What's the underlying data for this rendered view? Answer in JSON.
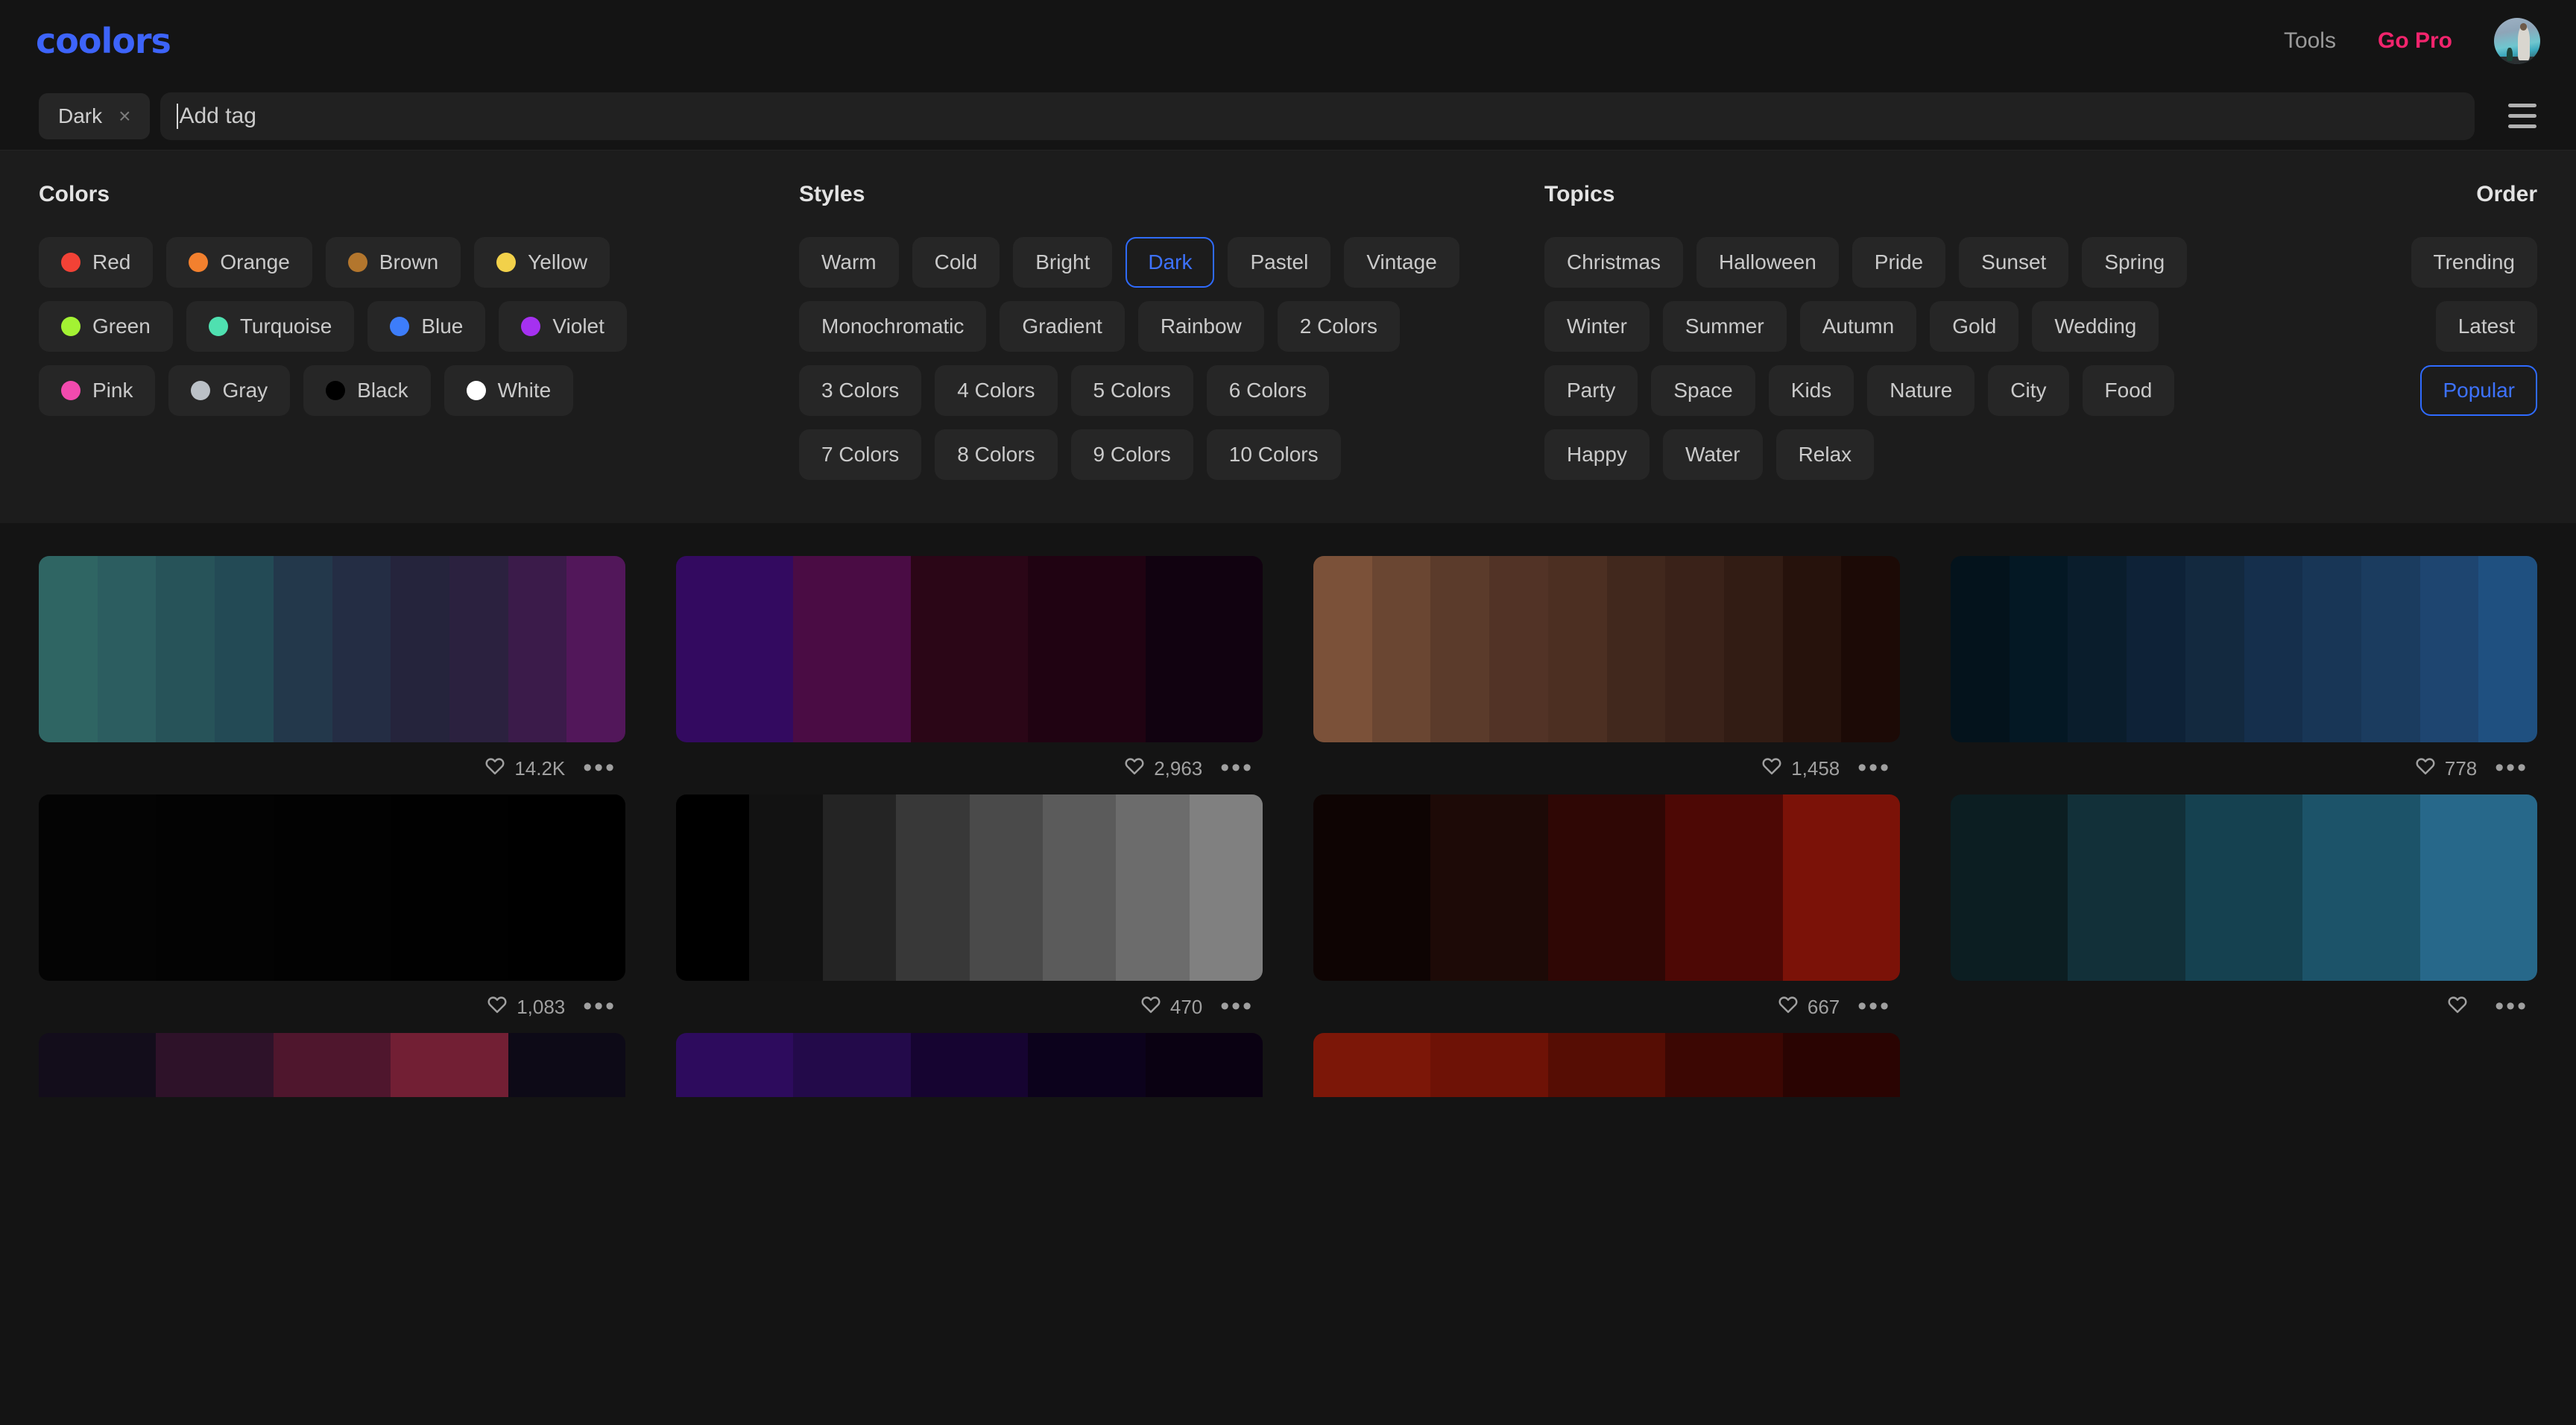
{
  "nav": {
    "logo": "coolors",
    "tools": "Tools",
    "go_pro": "Go Pro",
    "avatar_name": "user-avatar"
  },
  "tagbar": {
    "active_tag": "Dark",
    "remove_icon": "×",
    "input_value": "",
    "placeholder": "Add tag",
    "menu_icon": "hamburger-icon"
  },
  "filters": {
    "colors": {
      "title": "Colors",
      "rows": [
        [
          {
            "label": "Red",
            "color": "#f24236"
          },
          {
            "label": "Orange",
            "color": "#f2802e"
          },
          {
            "label": "Brown",
            "color": "#b3762d"
          },
          {
            "label": "Yellow",
            "color": "#f2d14a"
          }
        ],
        [
          {
            "label": "Green",
            "color": "#a3f233"
          },
          {
            "label": "Turquoise",
            "color": "#4fe0b0"
          },
          {
            "label": "Blue",
            "color": "#3d7dfa"
          },
          {
            "label": "Violet",
            "color": "#a531f0"
          }
        ],
        [
          {
            "label": "Pink",
            "color": "#f24aae"
          },
          {
            "label": "Gray",
            "color": "#bbc1c7"
          },
          {
            "label": "Black",
            "color": "#000000"
          },
          {
            "label": "White",
            "color": "#ffffff"
          }
        ]
      ]
    },
    "styles": {
      "title": "Styles",
      "rows": [
        [
          {
            "label": "Warm",
            "selected": false
          },
          {
            "label": "Cold",
            "selected": false
          },
          {
            "label": "Bright",
            "selected": false
          },
          {
            "label": "Dark",
            "selected": true
          },
          {
            "label": "Pastel",
            "selected": false
          },
          {
            "label": "Vintage",
            "selected": false
          }
        ],
        [
          {
            "label": "Monochromatic",
            "selected": false
          },
          {
            "label": "Gradient",
            "selected": false
          },
          {
            "label": "Rainbow",
            "selected": false
          },
          {
            "label": "2 Colors",
            "selected": false
          }
        ],
        [
          {
            "label": "3 Colors",
            "selected": false
          },
          {
            "label": "4 Colors",
            "selected": false
          },
          {
            "label": "5 Colors",
            "selected": false
          },
          {
            "label": "6 Colors",
            "selected": false
          }
        ],
        [
          {
            "label": "7 Colors",
            "selected": false
          },
          {
            "label": "8 Colors",
            "selected": false
          },
          {
            "label": "9 Colors",
            "selected": false
          },
          {
            "label": "10 Colors",
            "selected": false
          }
        ]
      ]
    },
    "topics": {
      "title": "Topics",
      "rows": [
        [
          {
            "label": "Christmas"
          },
          {
            "label": "Halloween"
          },
          {
            "label": "Pride"
          },
          {
            "label": "Sunset"
          },
          {
            "label": "Spring"
          }
        ],
        [
          {
            "label": "Winter"
          },
          {
            "label": "Summer"
          },
          {
            "label": "Autumn"
          },
          {
            "label": "Gold"
          },
          {
            "label": "Wedding"
          }
        ],
        [
          {
            "label": "Party"
          },
          {
            "label": "Space"
          },
          {
            "label": "Kids"
          },
          {
            "label": "Nature"
          },
          {
            "label": "City"
          },
          {
            "label": "Food"
          }
        ],
        [
          {
            "label": "Happy"
          },
          {
            "label": "Water"
          },
          {
            "label": "Relax"
          }
        ]
      ]
    },
    "order": {
      "title": "Order",
      "options": [
        {
          "label": "Trending",
          "selected": false
        },
        {
          "label": "Latest",
          "selected": false
        },
        {
          "label": "Popular",
          "selected": true
        }
      ]
    }
  },
  "palettes": [
    {
      "likes": "14.2K",
      "colors": [
        "#2f6563",
        "#2c5d60",
        "#275359",
        "#234a55",
        "#23384b",
        "#242d44",
        "#25243c",
        "#2b213f",
        "#3b1b4a",
        "#52175a"
      ]
    },
    {
      "likes": "2,963",
      "colors": [
        "#330a60",
        "#4a0c44",
        "#2b0617",
        "#200312",
        "#110210"
      ]
    },
    {
      "likes": "1,458",
      "colors": [
        "#7b5139",
        "#6a4632",
        "#5b3b2b",
        "#523326",
        "#4c2f22",
        "#41281d",
        "#3a2219",
        "#321c14",
        "#26120c",
        "#1c0a06"
      ]
    },
    {
      "likes": "778",
      "colors": [
        "#04131c",
        "#041824",
        "#0a1d2c",
        "#0e2237",
        "#13293f",
        "#152f4c",
        "#183656",
        "#1b3c5f",
        "#1e4570",
        "#1f5080"
      ]
    },
    {
      "likes": "1,083",
      "colors": [
        "#040404",
        "#030303",
        "#020202",
        "#010101",
        "#000000"
      ]
    },
    {
      "likes": "470",
      "colors": [
        "#000000",
        "#121212",
        "#242424",
        "#383838",
        "#4a4a4a",
        "#5b5b5b",
        "#6c6c6c",
        "#808080"
      ]
    },
    {
      "likes": "667",
      "colors": [
        "#0e0403",
        "#1d0a07",
        "#2f0705",
        "#4d0805",
        "#7b1208"
      ]
    },
    {
      "likes": "",
      "colors": [
        "#0c1e22",
        "#123039",
        "#154150",
        "#1c5369",
        "#27688a"
      ]
    },
    {
      "likes": "",
      "colors": [
        "#130d1b",
        "#2e1229",
        "#4f162d",
        "#721f34",
        "#0d0a17"
      ]
    },
    {
      "likes": "",
      "colors": [
        "#2d0b5d",
        "#230a4a",
        "#160431",
        "#0c021c",
        "#0a0112"
      ]
    },
    {
      "likes": "",
      "colors": [
        "#7c1708",
        "#6e1206",
        "#560d04",
        "#3c0703",
        "#2a0402"
      ]
    }
  ]
}
